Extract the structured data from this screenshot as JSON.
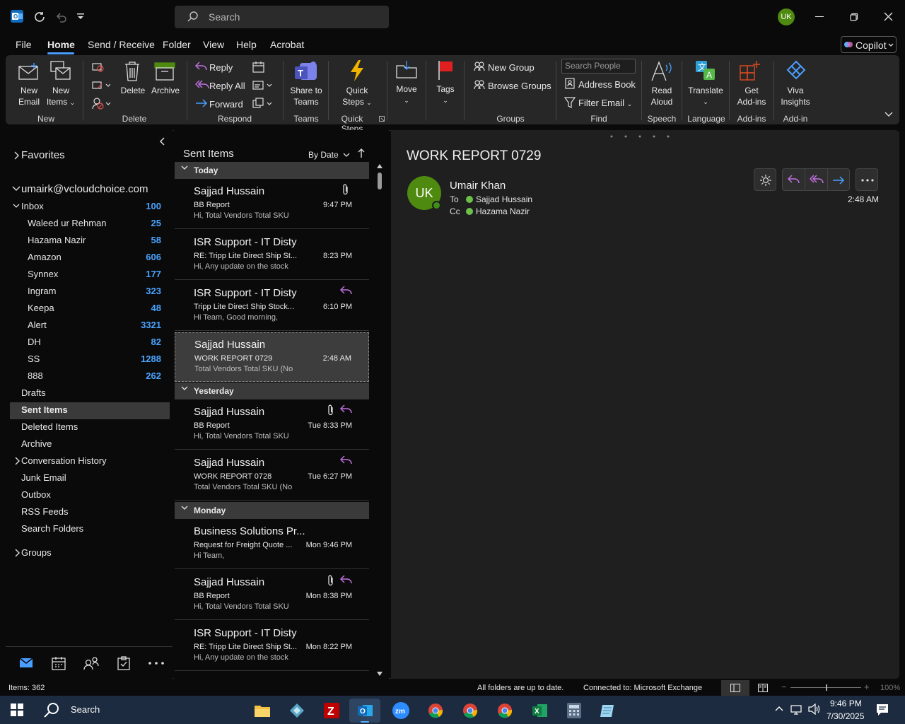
{
  "window": {
    "search_placeholder": "Search",
    "user_initials": "UK",
    "accent": "#4a9eff"
  },
  "menu": {
    "tabs": [
      "File",
      "Home",
      "Send / Receive",
      "Folder",
      "View",
      "Help",
      "Acrobat"
    ],
    "active": "Home",
    "copilot_label": "Copilot"
  },
  "ribbon": {
    "new_email": [
      "New",
      "Email"
    ],
    "new_items": [
      "New",
      "Items"
    ],
    "group_new": "New",
    "delete": "Delete",
    "archive": "Archive",
    "group_delete": "Delete",
    "reply": "Reply",
    "reply_all": "Reply All",
    "forward": "Forward",
    "group_respond": "Respond",
    "share_teams": [
      "Share to",
      "Teams"
    ],
    "group_teams": "Teams",
    "quick_steps": [
      "Quick",
      "Steps"
    ],
    "group_quick_steps": "Quick Steps",
    "move": "Move",
    "tags": "Tags",
    "new_group": "New Group",
    "browse_groups": "Browse Groups",
    "group_groups": "Groups",
    "search_people_placeholder": "Search People",
    "address_book": "Address Book",
    "filter_email": "Filter Email",
    "group_find": "Find",
    "read_aloud": [
      "Read",
      "Aloud"
    ],
    "group_speech": "Speech",
    "translate": "Translate",
    "group_language": "Language",
    "get_addins": [
      "Get",
      "Add-ins"
    ],
    "group_addins": "Add-ins",
    "viva": [
      "Viva",
      "Insights"
    ],
    "group_addin": "Add-in"
  },
  "nav": {
    "favorites": "Favorites",
    "account": "umairk@vcloudchoice.com",
    "inbox": {
      "label": "Inbox",
      "count": "100"
    },
    "subfolders": [
      {
        "label": "Waleed ur Rehman",
        "count": "25"
      },
      {
        "label": "Hazama Nazir",
        "count": "58"
      },
      {
        "label": "Amazon",
        "count": "606"
      },
      {
        "label": "Synnex",
        "count": "177"
      },
      {
        "label": "Ingram",
        "count": "323"
      },
      {
        "label": "Keepa",
        "count": "48"
      },
      {
        "label": "Alert",
        "count": "3321"
      },
      {
        "label": "DH",
        "count": "82"
      },
      {
        "label": "SS",
        "count": "1288"
      },
      {
        "label": "888",
        "count": "262"
      }
    ],
    "folders": [
      "Drafts",
      "Sent Items",
      "Deleted Items",
      "Archive",
      "Conversation History",
      "Junk Email",
      "Outbox",
      "RSS Feeds",
      "Search Folders"
    ],
    "groups": "Groups"
  },
  "list": {
    "title": "Sent Items",
    "sort": "By Date",
    "groups": [
      "Today",
      "Yesterday",
      "Monday"
    ],
    "messages": [
      {
        "from": "Sajjad Hussain",
        "subject": "BB Report",
        "preview": "Hi,  Total Vendors  Total SKU",
        "time": "9:47 PM"
      },
      {
        "from": "ISR Support - IT Disty",
        "subject": "RE: Tripp Lite Direct Ship St...",
        "preview": "Hi,  Any update on the stock",
        "time": "8:23 PM"
      },
      {
        "from": "ISR Support - IT Disty",
        "subject": "Tripp Lite Direct Ship Stock...",
        "preview": "Hi Team,  Good morning,",
        "time": "6:10 PM"
      },
      {
        "from": "Sajjad Hussain",
        "subject": "WORK REPORT 0729",
        "preview": "Total Vendors  Total SKU (No",
        "time": "2:48 AM"
      },
      {
        "from": "Sajjad Hussain",
        "subject": "BB Report",
        "preview": "Hi,  Total Vendors  Total SKU",
        "time": "Tue 8:33 PM"
      },
      {
        "from": "Sajjad Hussain",
        "subject": "WORK REPORT 0728",
        "preview": "Total Vendors  Total SKU (No",
        "time": "Tue 6:27 PM"
      },
      {
        "from": "Business Solutions Pr...",
        "subject": "Request for Freight Quote ...",
        "preview": "Hi Team,",
        "time": "Mon 9:46 PM"
      },
      {
        "from": "Sajjad Hussain",
        "subject": "BB Report",
        "preview": "Hi,  Total Vendors  Total SKU",
        "time": "Mon 8:38 PM"
      },
      {
        "from": "ISR Support - IT Disty",
        "subject": "RE: Tripp Lite Direct Ship St...",
        "preview": "Hi,  Any update on the stock",
        "time": "Mon 8:22 PM"
      }
    ]
  },
  "reading": {
    "subject": "WORK REPORT 0729",
    "sender": "Umair Khan",
    "initials": "UK",
    "to_label": "To",
    "to": "Sajjad Hussain",
    "cc_label": "Cc",
    "cc": "Hazama Nazir",
    "time": "2:48 AM"
  },
  "status": {
    "items": "Items: 362",
    "sync": "All folders are up to date.",
    "connection": "Connected to: Microsoft Exchange",
    "zoom": "100%"
  },
  "taskbar": {
    "search": "Search",
    "time": "9:46 PM",
    "date": "7/30/2025"
  }
}
